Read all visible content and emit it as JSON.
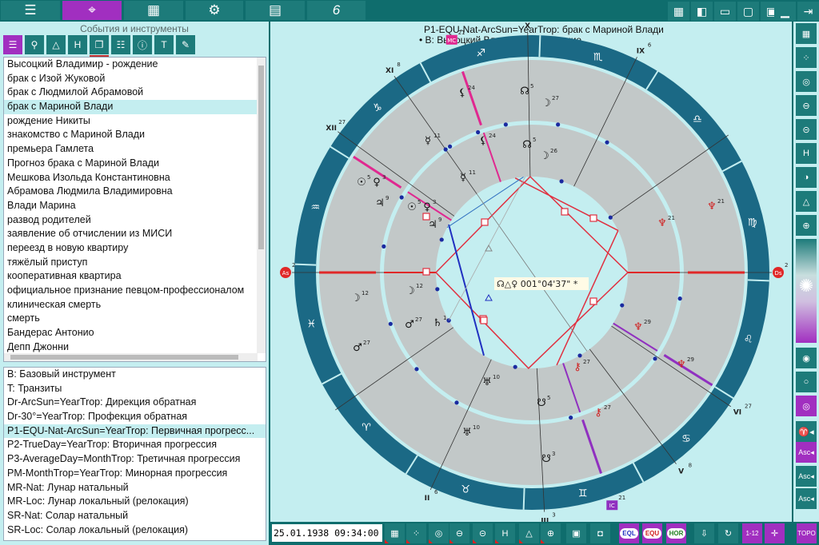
{
  "topbar": {
    "buttons": [
      {
        "icon": "menu-icon",
        "glyph": "☰"
      },
      {
        "icon": "chart-crosshair-icon",
        "glyph": "⌖",
        "active": true
      },
      {
        "icon": "grid-icon",
        "glyph": "▦"
      },
      {
        "icon": "gear-icon",
        "glyph": "⚙"
      },
      {
        "icon": "calculator-icon",
        "glyph": "▤"
      },
      {
        "icon": "logo-icon",
        "glyph": "6"
      }
    ],
    "layout_buttons": [
      {
        "icon": "grid-9-icon",
        "glyph": "▦"
      },
      {
        "icon": "layout-left-icon",
        "glyph": "◧"
      },
      {
        "icon": "layout-bottom-icon",
        "glyph": "▭"
      },
      {
        "icon": "layout-frame-icon",
        "glyph": "▢"
      },
      {
        "icon": "layout-top-icon",
        "glyph": "▣"
      },
      {
        "icon": "layout-line-icon",
        "glyph": "▁"
      },
      {
        "icon": "exit-icon",
        "glyph": "⇥"
      }
    ]
  },
  "left": {
    "title": "События и инструменты",
    "tools": [
      {
        "icon": "list-icon",
        "glyph": "☰",
        "active": true
      },
      {
        "icon": "gender-icon",
        "glyph": "⚲"
      },
      {
        "icon": "shapes-icon",
        "glyph": "△"
      },
      {
        "icon": "house-system-icon",
        "glyph": "H"
      },
      {
        "icon": "documents-icon",
        "glyph": "❐",
        "underline": true
      },
      {
        "icon": "checklist-icon",
        "glyph": "☷"
      },
      {
        "icon": "info-icon",
        "glyph": "ⓘ"
      },
      {
        "icon": "timeline-icon",
        "glyph": "T"
      },
      {
        "icon": "edit-icon",
        "glyph": "✎"
      }
    ],
    "events": [
      "Высоцкий Владимир - рождение",
      "брак с Изой Жуковой",
      "брак с Людмилой Абрамовой",
      "брак с Мариной Влади",
      "рождение Никиты",
      "знакомство с Мариной Влади",
      "премьера Гамлета",
      "Прогноз брака с Мариной Влади",
      "Мешкова Изольда Константиновна",
      "Абрамова Людмила Владимировна",
      "Влади Марина",
      "развод родителей",
      "заявление об отчислении из МИСИ",
      "переезд в новую квартиру",
      "тяжёлый приступ",
      "кооперативная квартира",
      "официальное признание певцом-профессионалом",
      "клиническая смерть",
      "смерть",
      "Бандерас Антонио",
      "Депп Джонни"
    ],
    "selected_event": 3,
    "tools_list": [
      "B: Базовый инструмент",
      "T: Транзиты",
      "Dr-ArcSun=YearTrop: Дирекция обратная",
      "Dr-30°=YearTrop: Профекция обратная",
      "P1-EQU-Nat-ArcSun=YearTrop: Первичная прогресс...",
      "P2-TrueDay=YearTrop: Вторичная прогрессия",
      "P3-AverageDay=MonthTrop: Третичная прогрессия",
      "PM-MonthTrop=YearTrop: Минорная прогрессия",
      "MR-Nat: Лунар натальный",
      "MR-Loc: Лунар локальный (релокация)",
      "SR-Nat: Солар натальный",
      "SR-Loc: Солар локальный (релокация)"
    ],
    "selected_tool": 4
  },
  "chart": {
    "title": "P1-EQU-Nat-ArcSun=YearTrop: брак с Мариной Влади",
    "subtitle": "• B: Высоцкий Владимир - рождение",
    "signs": [
      "♈",
      "♉",
      "♊",
      "♋",
      "♌",
      "♍",
      "♎",
      "♏",
      "♐",
      "♑",
      "♒",
      "♓"
    ],
    "houses": [
      {
        "label": "XI",
        "deg": "8"
      },
      {
        "label": "XII",
        "deg": "27"
      },
      {
        "label": "X",
        "deg": "3"
      },
      {
        "label": "IX",
        "deg": "6"
      },
      {
        "label": "VI",
        "deg": "27"
      },
      {
        "label": "V",
        "deg": "8"
      },
      {
        "label": "III",
        "deg": "3"
      },
      {
        "label": "II",
        "deg": "6"
      }
    ],
    "angles": [
      {
        "label": "As",
        "deg": "2",
        "color": "#e02828"
      },
      {
        "label": "Ds",
        "deg": "2",
        "color": "#e02828"
      },
      {
        "label": "MC",
        "deg": "21",
        "color": "#e02890"
      },
      {
        "label": "IC",
        "deg": "21",
        "color": "#9030c0"
      }
    ],
    "planets_outer": [
      {
        "glyph": "⚸",
        "deg": "24"
      },
      {
        "glyph": "☊",
        "deg": "5"
      },
      {
        "glyph": "☽",
        "deg": "27"
      },
      {
        "glyph": "☿",
        "deg": "11"
      },
      {
        "glyph": "☉",
        "deg": "5"
      },
      {
        "glyph": "♀",
        "deg": "3"
      },
      {
        "glyph": "♃",
        "deg": "9"
      },
      {
        "glyph": "♆",
        "deg": "21"
      },
      {
        "glyph": "☽",
        "deg": "12"
      },
      {
        "glyph": "♂",
        "deg": "27"
      },
      {
        "glyph": "♆",
        "deg": "29"
      },
      {
        "glyph": "⚷",
        "deg": "27"
      },
      {
        "glyph": "♅",
        "deg": "10"
      },
      {
        "glyph": "☋",
        "deg": "3"
      }
    ],
    "planets_inner": [
      {
        "glyph": "⚸",
        "deg": "24"
      },
      {
        "glyph": "☊",
        "deg": "5"
      },
      {
        "glyph": "☽",
        "deg": "26"
      },
      {
        "glyph": "☿",
        "deg": "11"
      },
      {
        "glyph": "☉",
        "deg": "5"
      },
      {
        "glyph": "♀",
        "deg": "3"
      },
      {
        "glyph": "♃",
        "deg": "9"
      },
      {
        "glyph": "♆",
        "deg": "21"
      },
      {
        "glyph": "☽",
        "deg": "12"
      },
      {
        "glyph": "♂",
        "deg": "27"
      },
      {
        "glyph": "♄",
        "deg": "1"
      },
      {
        "glyph": "♆",
        "deg": "29"
      },
      {
        "glyph": "⚷",
        "deg": "27"
      },
      {
        "glyph": "♅",
        "deg": "10"
      },
      {
        "glyph": "☋",
        "deg": "5"
      }
    ],
    "tooltip": "☊△♀ 001°04'37\"  *",
    "colors": {
      "band": "#1b6985",
      "ring": "#c2c8c8",
      "inner": "#c4eef0",
      "aspect_square": "#e03040",
      "aspect_trine": "#2030c0"
    }
  },
  "bottom": {
    "datetime": "25.01.1938 09:34:00",
    "buttons": [
      {
        "icon": "aspect-grid-icon",
        "glyph": "▦"
      },
      {
        "icon": "planets-icon",
        "glyph": "⁘"
      },
      {
        "icon": "ring-icon",
        "glyph": "◎"
      },
      {
        "icon": "ascendant-icon",
        "glyph": "⊖"
      },
      {
        "icon": "horizon-icon",
        "glyph": "⊝"
      },
      {
        "icon": "house-system-icon",
        "glyph": "H"
      },
      {
        "icon": "shapes-icon",
        "glyph": "△"
      },
      {
        "icon": "search-chart-icon",
        "glyph": "⊕"
      },
      {
        "icon": "photo-icon",
        "glyph": "▣"
      },
      {
        "icon": "camera-icon",
        "glyph": "◘"
      },
      {
        "label": "EQL"
      },
      {
        "label": "EQU"
      },
      {
        "label": "HOR"
      },
      {
        "icon": "arrow-down-icon",
        "glyph": "⇩"
      },
      {
        "icon": "rotate-icon",
        "glyph": "↻"
      },
      {
        "label": "1-12"
      },
      {
        "icon": "cross-icon",
        "glyph": "✛"
      },
      {
        "label": "TOPO"
      }
    ]
  },
  "right": {
    "buttons": [
      {
        "icon": "aspect-grid-icon",
        "glyph": "▦"
      },
      {
        "icon": "planets-icon",
        "glyph": "⁘"
      },
      {
        "icon": "ring-icon",
        "glyph": "◎"
      },
      {
        "icon": "ascendant-icon",
        "glyph": "⊖"
      },
      {
        "icon": "horizon-icon",
        "glyph": "⊝"
      },
      {
        "icon": "house-system-icon",
        "glyph": "H"
      },
      {
        "icon": "yin-yang-icon",
        "glyph": "◑"
      },
      {
        "icon": "shapes-icon",
        "glyph": "△"
      },
      {
        "icon": "search-chart-icon",
        "glyph": "⊕"
      },
      {
        "icon": "wheel-icon",
        "glyph": "✺"
      },
      {
        "icon": "dot-ring-icon",
        "glyph": "◉"
      },
      {
        "icon": "ring-outline-icon",
        "glyph": "○"
      },
      {
        "icon": "ring-filled-icon",
        "glyph": "◎"
      },
      {
        "icon": "aries-asc-icon",
        "glyph": "♈◂"
      },
      {
        "label": "Asc◂"
      },
      {
        "label": "Asc◂"
      },
      {
        "label": "Asc◂"
      }
    ]
  }
}
